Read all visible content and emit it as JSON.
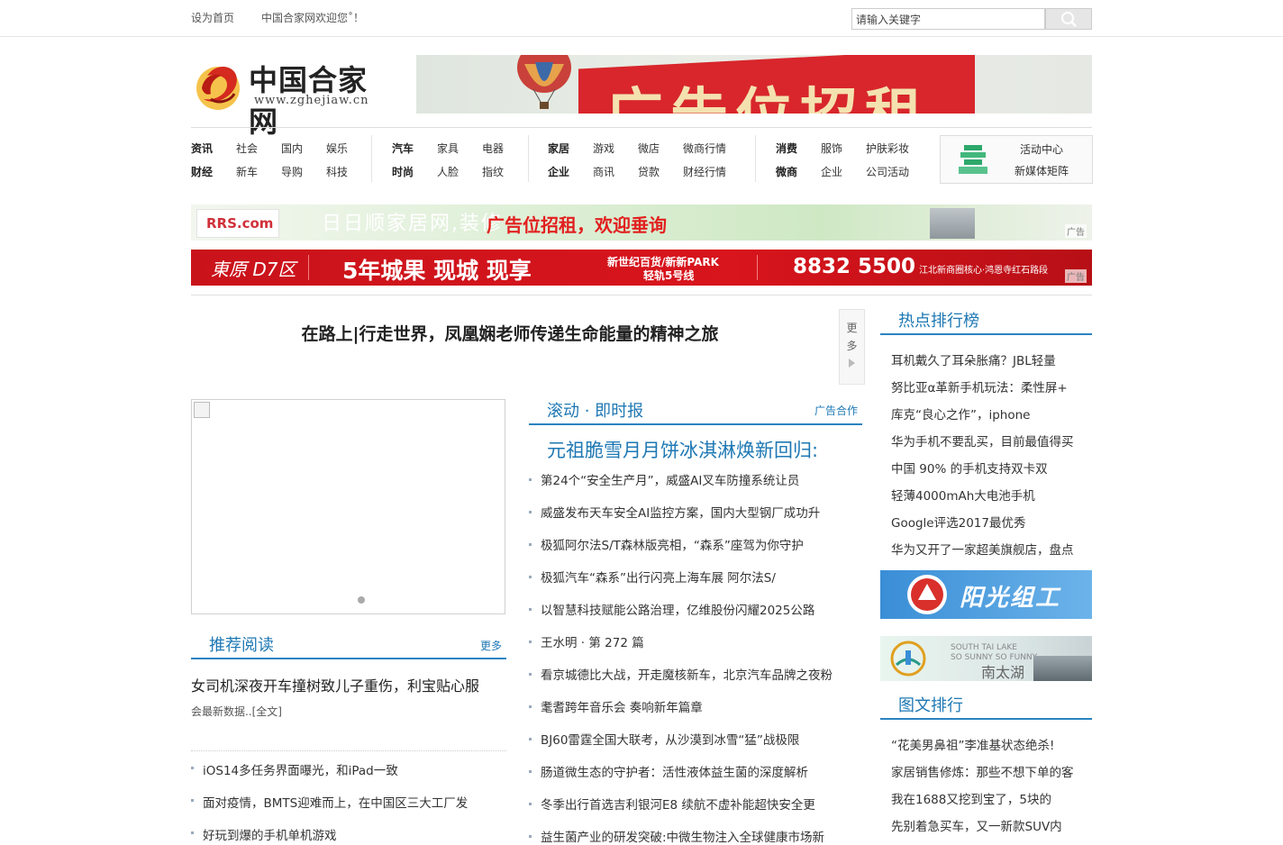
{
  "topbar": {
    "set_home": "设为首页",
    "welcome": "中国合家网欢迎您˚！",
    "search_placeholder": "请输入关键字"
  },
  "logo": {
    "name": "中国合家网",
    "url": "www.zghejiaw.cn"
  },
  "banner_top": {
    "text": "广告位招租"
  },
  "nav": {
    "group1": {
      "row1": [
        "资讯",
        "社会",
        "国内",
        "娱乐"
      ],
      "row2": [
        "财经",
        "新车",
        "导购",
        "科技"
      ]
    },
    "group2": {
      "row1": [
        "汽车",
        "家具",
        "电器"
      ],
      "row2": [
        "时尚",
        "人脸",
        "指纹"
      ]
    },
    "group3": {
      "row1": [
        "家居",
        "游戏",
        "微店",
        "微商行情"
      ],
      "row2": [
        "企业",
        "商讯",
        "贷款",
        "财经行情"
      ]
    },
    "group4": {
      "row1": [
        "消费",
        "服饰",
        "护肤彩妆"
      ],
      "row2": [
        "微商",
        "企业",
        "公司活动"
      ]
    },
    "activity": {
      "line1": "活动中心",
      "line2": "新媒体矩阵"
    }
  },
  "banner_rrs": {
    "brand": "RRS.com",
    "main": "日日顺家居网,装修",
    "overlay": "广告位招租，欢迎垂询",
    "tag": "广告"
  },
  "banner_d7": {
    "logo": "東原 D7区",
    "slogan": "5年城果 现城 现享",
    "sub1": "新世纪百货/新新PARK",
    "sub2": "轻轨5号线",
    "phone": "8832 5500",
    "addr": "江北新商圈核心·鸿恩寺红石路段",
    "tag": "广告"
  },
  "headline": {
    "title": "在路上|行走世界，凤凰娴老师传递生命能量的精神之旅",
    "more": [
      "更",
      "多"
    ]
  },
  "recommend": {
    "title": "推荐阅读",
    "more": "更多",
    "feature_title": "女司机深夜开车撞树致儿子重伤，利宝贴心服",
    "feature_desc": "会最新数据..[全文]",
    "items": [
      "iOS14多任务界面曝光，和iPad一致",
      "面对疫情，BMTS迎难而上，在中国区三大工厂发",
      "好玩到爆的手机单机游戏"
    ]
  },
  "rolling": {
    "title": "滚动 · 即时报",
    "ad": "广告合作",
    "lead": "元祖脆雪月月饼冰淇淋焕新回归:",
    "items": [
      "第24个“安全生产月”，威盛AI叉车防撞系统让员",
      "威盛发布天车安全AI监控方案，国内大型钢厂成功升",
      "极狐阿尔法S/T森林版亮相，“森系”座驾为你守护",
      "极狐汽车“森系”出行闪亮上海车展 阿尔法S/",
      "以智慧科技赋能公路治理，亿维股份闪耀2025公路",
      "王水明 · 第 272 篇",
      "看京城德比大战，开走魔核新车，北京汽车品牌之夜粉",
      "耄耆跨年音乐会 奏响新年篇章",
      "BJ60雷霆全国大联考，从沙漠到冰雪“猛”战极限",
      "肠道微生态的守护者：活性液体益生菌的深度解析",
      "冬季出行首选吉利银河E8 续航不虚补能超快安全更",
      "益生菌产业的研发突破:中微生物注入全球健康市场新"
    ]
  },
  "hot": {
    "title": "热点排行榜",
    "items": [
      "耳机戴久了耳朵胀痛？JBL轻量",
      "努比亚α革新手机玩法：柔性屏+",
      "库克“良心之作”，iphone",
      "华为手机不要乱买，目前最值得买",
      "中国 90% 的手机支持双卡双",
      "轻薄4000mAh大电池手机",
      "Google评选2017最优秀",
      "华为又开了一家超美旗舰店，盘点"
    ]
  },
  "ads": {
    "sunshine": "阳光组工",
    "south_lake_cn": "南太湖",
    "south_lake_en1": "SOUTH TAI LAKE",
    "south_lake_en2": "SO SUNNY SO FUNNY"
  },
  "photo_rank": {
    "title": "图文排行",
    "items": [
      "“花美男鼻祖”李准基状态绝杀!",
      "家居销售修炼：那些不想下单的客",
      "我在1688又挖到宝了，5块的",
      "先别着急买车，又一新款SUV内"
    ]
  }
}
